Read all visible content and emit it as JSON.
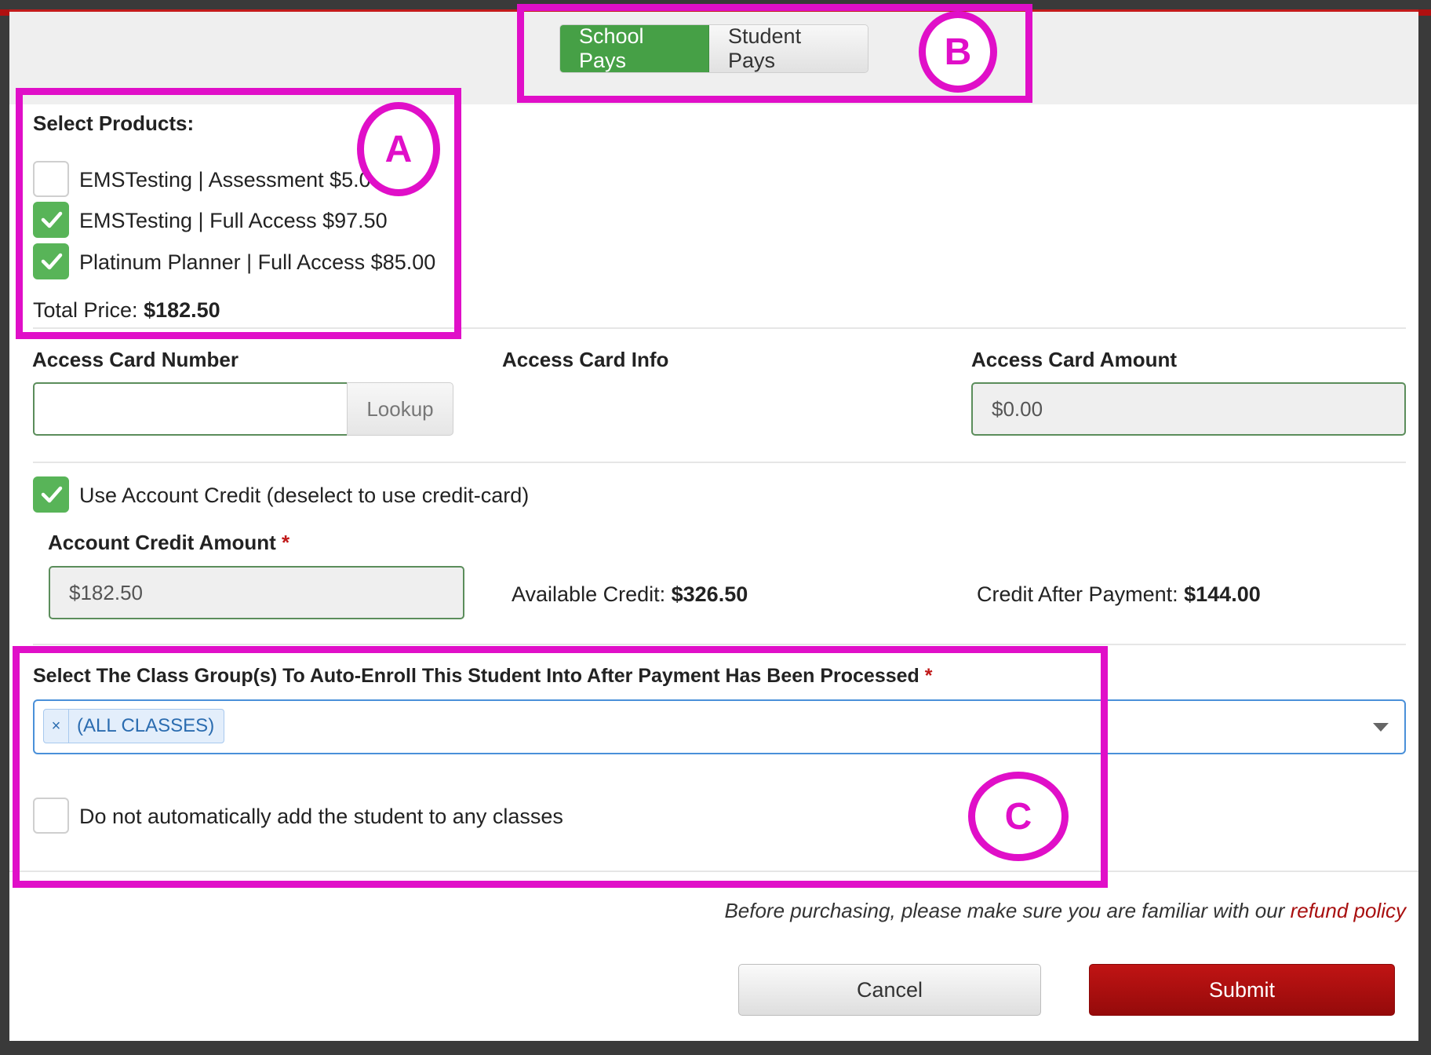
{
  "payment_toggle": {
    "school_pays": "School Pays",
    "student_pays": "Student Pays",
    "selected": "School Pays"
  },
  "products": {
    "heading": "Select Products:",
    "items": [
      {
        "label": "EMSTesting | Assessment $5.00",
        "checked": false
      },
      {
        "label": "EMSTesting | Full Access $97.50",
        "checked": true
      },
      {
        "label": "Platinum Planner | Full Access $85.00",
        "checked": true
      }
    ],
    "total_label": "Total Price:",
    "total_value": "$182.50"
  },
  "access_card": {
    "number_label": "Access Card Number",
    "number_value": "",
    "lookup_label": "Lookup",
    "info_label": "Access Card Info",
    "amount_label": "Access Card Amount",
    "amount_value": "$0.00"
  },
  "account_credit": {
    "use_label": "Use Account Credit (deselect to use credit-card)",
    "use_checked": true,
    "amount_label": "Account Credit Amount",
    "required_mark": "*",
    "amount_value": "$182.50",
    "available_label": "Available Credit:",
    "available_value": "$326.50",
    "after_label": "Credit After Payment:",
    "after_value": "$144.00"
  },
  "class_groups": {
    "label": "Select The Class Group(s) To Auto-Enroll This Student Into After Payment Has Been Processed",
    "required_mark": "*",
    "chip_remove": "×",
    "chip_label": "(ALL CLASSES)",
    "no_auto_label": "Do not automatically add the student to any classes",
    "no_auto_checked": false
  },
  "footer": {
    "note_prefix": "Before purchasing, please make sure you are familiar with our ",
    "refund_link": "refund policy",
    "cancel_label": "Cancel",
    "submit_label": "Submit"
  },
  "annotations": {
    "a": "A",
    "b": "B",
    "c": "C",
    "color": "#e00fc8"
  },
  "colors": {
    "accent_green": "#46a046",
    "submit_red": "#a80f0f",
    "focus_blue": "#4a90d9"
  }
}
